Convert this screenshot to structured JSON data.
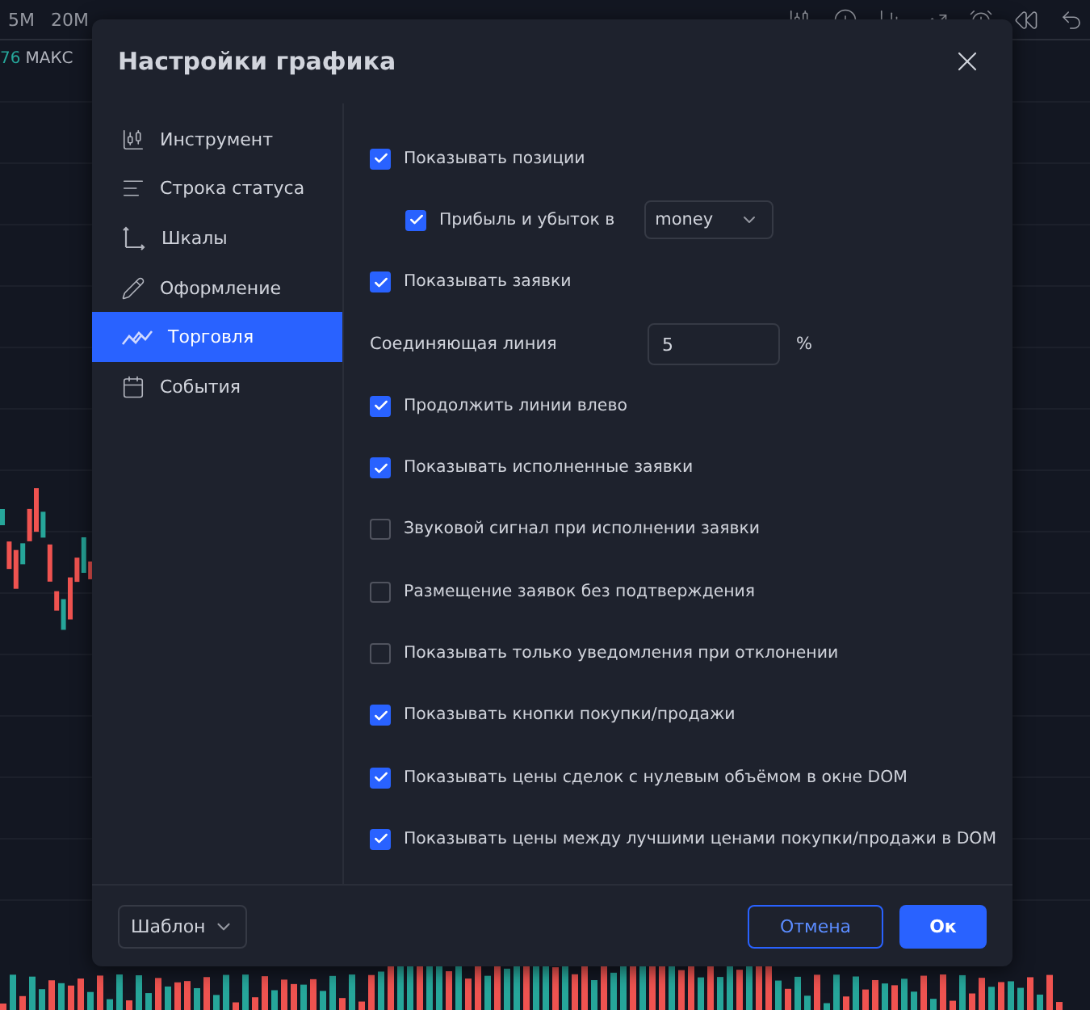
{
  "toolbar": {
    "timeframes": [
      "5M",
      "20M"
    ]
  },
  "legend": {
    "value_1": "76",
    "label": "МАКС"
  },
  "dialog": {
    "title": "Настройки графика",
    "sidebar": [
      {
        "label": "Инструмент",
        "selected": false
      },
      {
        "label": "Строка статуса",
        "selected": false
      },
      {
        "label": "Шкалы",
        "selected": false
      },
      {
        "label": "Оформление",
        "selected": false
      },
      {
        "label": "Торговля",
        "selected": true
      },
      {
        "label": "События",
        "selected": false
      }
    ],
    "options": [
      {
        "kind": "checkbox",
        "label": "Показывать позиции",
        "checked": true,
        "children": [
          {
            "kind": "checkbox_select",
            "label": "Прибыль и убыток в",
            "checked": true,
            "value": "money"
          }
        ]
      },
      {
        "kind": "checkbox",
        "label": "Показывать заявки",
        "checked": true
      },
      {
        "kind": "input",
        "label": "Соединяющая линия",
        "value": "5",
        "unit": "%"
      },
      {
        "kind": "checkbox",
        "label": "Продолжить линии влево",
        "checked": true
      },
      {
        "kind": "checkbox",
        "label": "Показывать исполненные заявки",
        "checked": true
      },
      {
        "kind": "checkbox",
        "label": "Звуковой сигнал при исполнении заявки",
        "checked": false
      },
      {
        "kind": "checkbox",
        "label": "Размещение заявок без подтверждения",
        "checked": false
      },
      {
        "kind": "checkbox",
        "label": "Показывать только уведомления при отклонении",
        "checked": false
      },
      {
        "kind": "checkbox",
        "label": "Показывать кнопки покупки/продажи",
        "checked": true
      },
      {
        "kind": "checkbox",
        "label": "Показывать цены сделок с нулевым объёмом в окне DOM",
        "checked": true
      },
      {
        "kind": "checkbox",
        "label": "Показывать цены между лучшими ценами покупки/продажи в DOM",
        "checked": true
      }
    ],
    "template": "Шаблон",
    "cancel": "Отмена",
    "ok": "Ок"
  }
}
